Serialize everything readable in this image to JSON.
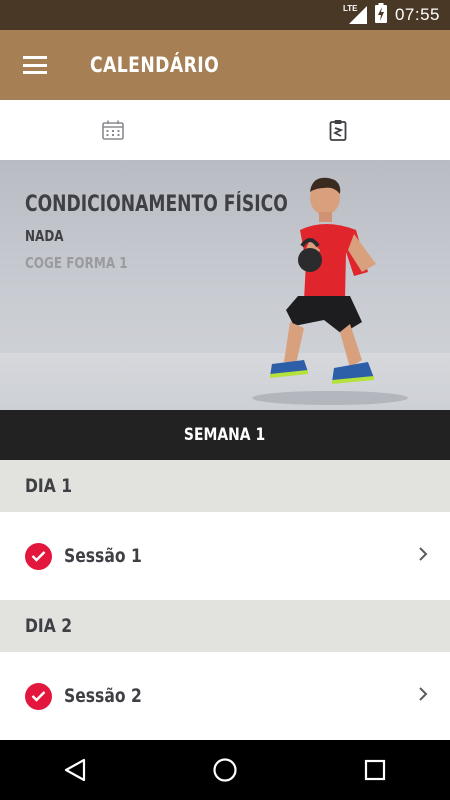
{
  "status_bar": {
    "network": "LTE",
    "time": "07:55"
  },
  "app_bar": {
    "title": "CALENDÁRIO",
    "menu_icon": "hamburger-menu-icon"
  },
  "tabs": [
    {
      "icon": "calendar-icon",
      "active": false
    },
    {
      "icon": "clipboard-plan-icon",
      "active": true
    }
  ],
  "hero": {
    "title": "CONDICIONAMENTO FÍSICO",
    "level": "NADA",
    "subtitle": "COGE FORMA 1"
  },
  "week": {
    "label": "SEMANA 1"
  },
  "days": [
    {
      "label": "DIA 1",
      "session": {
        "label": "Sessão 1",
        "completed": true
      }
    },
    {
      "label": "DIA 2",
      "session": {
        "label": "Sessão 2",
        "completed": true
      }
    }
  ],
  "colors": {
    "status_bar": "#4a3826",
    "app_bar": "#a77f55",
    "week_bar": "#222223",
    "day_header": "#e2e3df",
    "check": "#e3173e"
  },
  "nav": [
    "back-icon",
    "home-icon",
    "recents-icon"
  ]
}
